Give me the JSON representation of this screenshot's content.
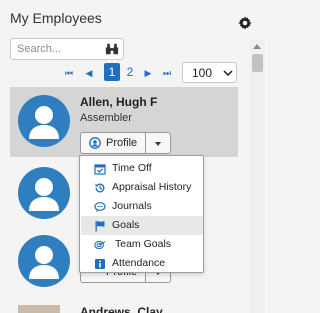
{
  "header": {
    "title": "My Employees",
    "settings_icon": "gear-icon"
  },
  "search": {
    "placeholder": "Search...",
    "icon": "binoculars-icon"
  },
  "pagination": {
    "first_label": "⏮",
    "prev_label": "◀",
    "pages": [
      "1",
      "2"
    ],
    "current_page": "1",
    "next_label": "▶",
    "last_label": "⏭",
    "page_size": "100"
  },
  "employees": [
    {
      "name": "Allen, Hugh F",
      "role": "Assembler",
      "profile_label": "Profile"
    },
    {
      "name": "",
      "role": "",
      "profile_label": "Profile"
    },
    {
      "name": "",
      "role": "",
      "profile_label": "Profile"
    },
    {
      "name": "Andrews, Clay"
    }
  ],
  "profile_menu": {
    "items": [
      {
        "label": "Time Off",
        "icon": "calendar-check-icon"
      },
      {
        "label": "Appraisal History",
        "icon": "history-icon"
      },
      {
        "label": "Journals",
        "icon": "comment-icon"
      },
      {
        "label": "Goals",
        "icon": "flag-icon"
      },
      {
        "label": "Team Goals",
        "icon": "target-icon"
      },
      {
        "label": "Attendance",
        "icon": "info-icon"
      }
    ],
    "highlighted": "Goals"
  },
  "colors": {
    "accent": "#1f6fbf",
    "avatar": "#2f7fc0",
    "selected_row": "#d5d5d5"
  }
}
